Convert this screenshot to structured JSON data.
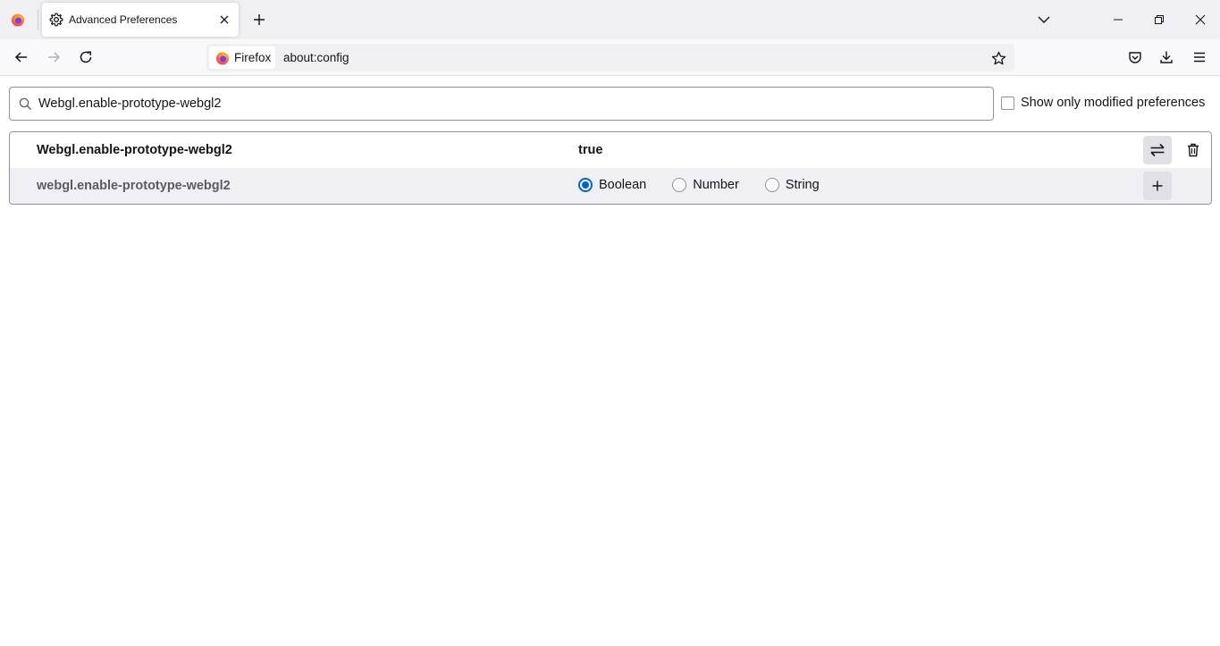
{
  "tab": {
    "title": "Advanced Preferences"
  },
  "urlbar": {
    "identity_label": "Firefox",
    "url": "about:config"
  },
  "search": {
    "value": "Webgl.enable-prototype-webgl2"
  },
  "filter": {
    "show_modified_label": "Show only modified preferences",
    "checked": false
  },
  "preferences": [
    {
      "name": "Webgl.enable-prototype-webgl2",
      "value": "true"
    },
    {
      "name": "webgl.enable-prototype-webgl2",
      "type_options": [
        "Boolean",
        "Number",
        "String"
      ],
      "selected_type": "Boolean"
    }
  ],
  "icons": {
    "firefox_logo": "firefox-logo-icon",
    "tab_icon": "gear-icon",
    "toggle": "swap-arrows-icon",
    "delete": "trash-icon",
    "add": "plus-icon"
  },
  "colors": {
    "accent": "#0061e0",
    "tabstrip_bg": "#f0f0f4",
    "row_alt_bg": "#f0f0f4"
  }
}
